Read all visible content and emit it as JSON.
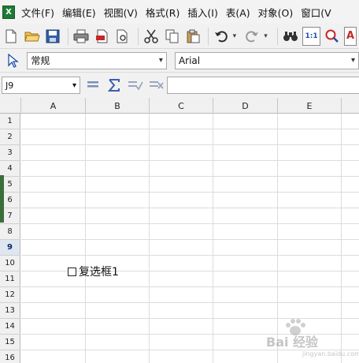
{
  "app": {
    "icon_letter": "X"
  },
  "menu": [
    {
      "label": "文件(F)"
    },
    {
      "label": "编辑(E)"
    },
    {
      "label": "视图(V)"
    },
    {
      "label": "格式(R)"
    },
    {
      "label": "插入(I)"
    },
    {
      "label": "表(A)"
    },
    {
      "label": "对象(O)"
    },
    {
      "label": "窗口(V"
    }
  ],
  "toolbar": {
    "icons": [
      "new-document-icon",
      "open-folder-icon",
      "save-icon",
      "print-icon",
      "export-pdf-icon",
      "print-preview-icon",
      "cut-icon",
      "copy-icon",
      "paste-icon",
      "undo-icon",
      "redo-icon",
      "find-icon",
      "zoom-100-icon",
      "zoom-icon",
      "font-color-icon"
    ],
    "zoom_label": "1:1",
    "font_color_letter": "A"
  },
  "format_bar": {
    "style_value": "常规",
    "font_value": "Arial"
  },
  "formula_bar": {
    "cell_ref": "J9",
    "formula_value": ""
  },
  "sheet": {
    "columns": [
      "A",
      "B",
      "C",
      "D",
      "E"
    ],
    "rows": [
      "1",
      "2",
      "3",
      "4",
      "5",
      "6",
      "7",
      "8",
      "9",
      "10",
      "11",
      "12",
      "13",
      "14",
      "15",
      "16"
    ],
    "active_row": "9",
    "checkbox": {
      "label": "复选框1",
      "checked": false
    }
  },
  "watermark": {
    "text": "Bai 经验",
    "sub": "jingyan.baidu.com"
  },
  "colors": {
    "app_icon_green": "#1f7a38",
    "toolbar_bg": "#f1f1f1",
    "active_row_header": "#dfe6f0",
    "red_accent": "#c62828",
    "blue_accent": "#1e4fa8"
  }
}
